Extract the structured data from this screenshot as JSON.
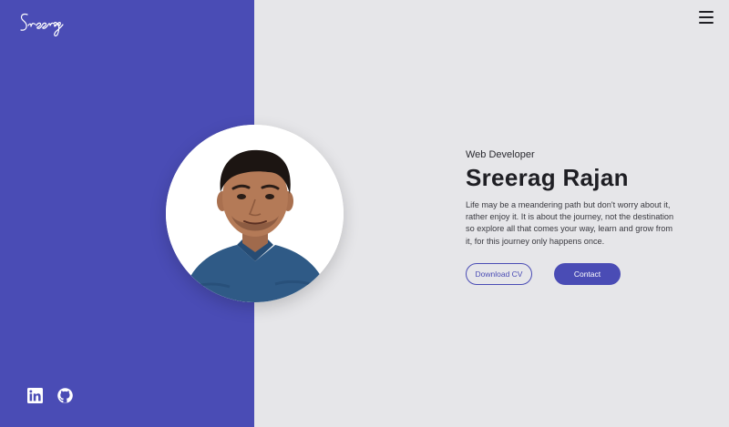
{
  "brand": {
    "logo_text": "Sreerag",
    "accent_color": "#4a4cb5",
    "background_color": "#e6e6e9"
  },
  "header": {
    "menu_icon": "hamburger-menu-icon"
  },
  "profile": {
    "role": "Web Developer",
    "name": "Sreerag Rajan",
    "bio": "Life may be a meandering path but don't worry about it, rather enjoy it. It is about the journey, not the destination so explore all that comes your way, learn and grow from it, for this journey only happens once.",
    "photo_alt": "Sreerag Rajan"
  },
  "actions": {
    "download_cv_label": "Download CV",
    "contact_label": "Contact"
  },
  "social": {
    "items": [
      {
        "icon": "linkedin-icon",
        "label": "LinkedIn"
      },
      {
        "icon": "github-icon",
        "label": "GitHub"
      }
    ]
  }
}
